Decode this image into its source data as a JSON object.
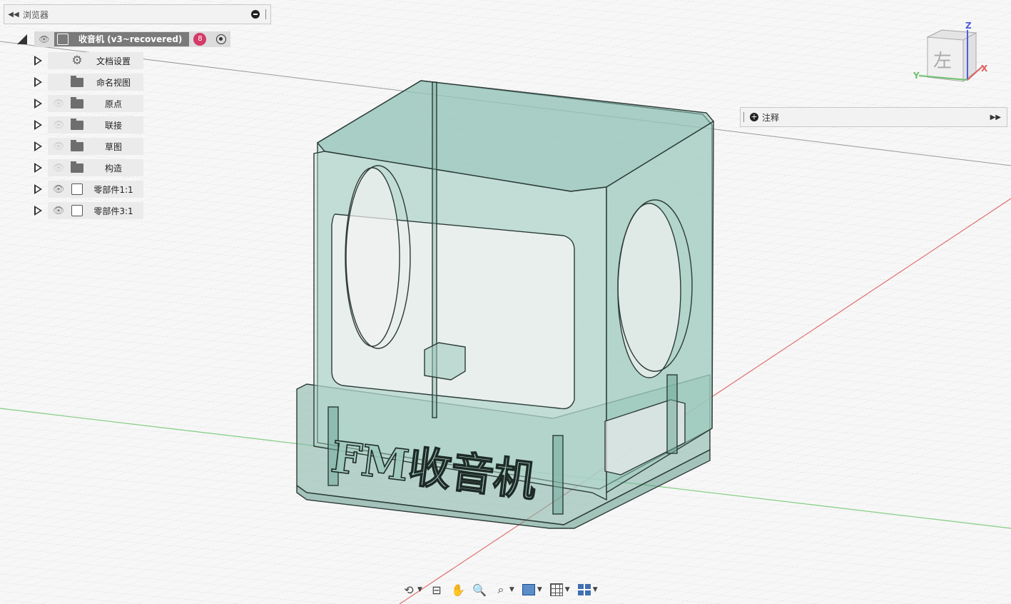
{
  "browser": {
    "title": "浏览器",
    "root": {
      "name": "收音机 (v3~recovered)",
      "badge": "8"
    },
    "items": [
      {
        "label": "文档设置",
        "icon": "gear-icon",
        "visibility": "none"
      },
      {
        "label": "命名视图",
        "icon": "folder-icon",
        "visibility": "none"
      },
      {
        "label": "原点",
        "icon": "folder-icon",
        "visibility": "hidden"
      },
      {
        "label": "联接",
        "icon": "folder-icon",
        "visibility": "hidden"
      },
      {
        "label": "草图",
        "icon": "folder-icon",
        "visibility": "hidden"
      },
      {
        "label": "构造",
        "icon": "folder-icon",
        "visibility": "hidden"
      },
      {
        "label": "零部件1:1",
        "icon": "component-icon",
        "visibility": "visible"
      },
      {
        "label": "零部件3:1",
        "icon": "component-icon",
        "visibility": "visible"
      }
    ]
  },
  "notes": {
    "title": "注释"
  },
  "viewcube": {
    "face": "左",
    "axis_z": "Z",
    "axis_x": "X",
    "axis_y": "Y"
  },
  "model": {
    "engraving": "FM收音机"
  },
  "colors": {
    "model": "#6fa99a",
    "model_edge": "#2c3b36",
    "x_axis": "#e06060",
    "y_axis": "#60c060",
    "badge": "#d43a67"
  }
}
